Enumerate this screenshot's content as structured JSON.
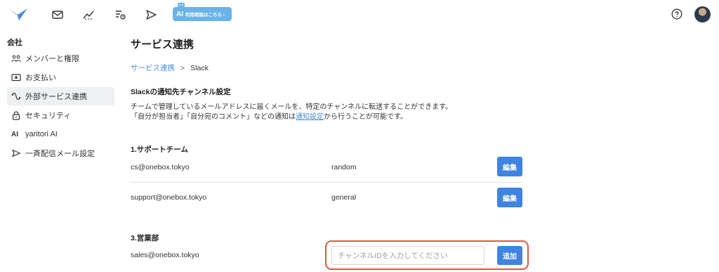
{
  "header": {
    "ai_badge_mark": "AI",
    "ai_badge_text": "利用相談はこちら ›",
    "icons": [
      "logo-icon",
      "mail-icon",
      "analytics-icon",
      "task-icon",
      "send-icon",
      "help-icon",
      "avatar"
    ]
  },
  "sidebar": {
    "heading": "会社",
    "items": [
      {
        "label": "メンバーと権限",
        "icon": "members-icon"
      },
      {
        "label": "お支払い",
        "icon": "payment-icon"
      },
      {
        "label": "外部サービス連携",
        "icon": "integration-icon",
        "active": true
      },
      {
        "label": "セキュリティ",
        "icon": "lock-icon"
      },
      {
        "label": "yaritori AI",
        "icon": "ai-icon"
      },
      {
        "label": "一斉配信メール設定",
        "icon": "broadcast-icon"
      }
    ]
  },
  "main": {
    "title": "サービス連携",
    "breadcrumb": {
      "link": "サービス連携",
      "separator": ">",
      "current": "Slack"
    },
    "section_heading": "Slackの通知先チャンネル設定",
    "desc_line1": "チームで管理しているメールアドレスに届くメールを、特定のチャンネルに転送することができます。",
    "desc_line2_before": "「自分が担当者」「自分宛のコメント」などの通知は",
    "desc_line2_link": "通知設定",
    "desc_line2_after": "から行うことが可能です。",
    "teams": [
      {
        "heading": "1.サポートチーム",
        "rows": [
          {
            "email": "cs@onebox.tokyo",
            "channel": "random",
            "button": "編集"
          },
          {
            "email": "support@onebox.tokyo",
            "channel": "general",
            "button": "編集"
          }
        ]
      },
      {
        "heading": "3.営業部",
        "rows": [
          {
            "email": "sales@onebox.tokyo",
            "input_placeholder": "チャンネルIDを入力してください",
            "input_value": "",
            "button": "追加"
          }
        ]
      }
    ]
  },
  "colors": {
    "accent": "#3f84df",
    "link": "#4a8fd8",
    "highlight": "#e0583e",
    "badge": "#6ab3e8"
  }
}
